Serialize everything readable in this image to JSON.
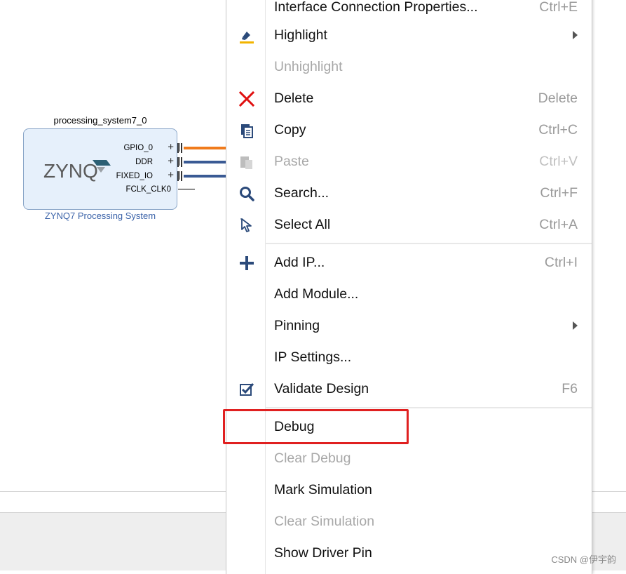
{
  "canvas": {
    "block": {
      "instance_name": "processing_system7_0",
      "logo_text": "ZYNQ",
      "caption": "ZYNQ7 Processing System",
      "ports": [
        {
          "label": "GPIO_0",
          "has_plus": true
        },
        {
          "label": "DDR",
          "has_plus": true
        },
        {
          "label": "FIXED_IO",
          "has_plus": true
        },
        {
          "label": "FCLK_CLK0",
          "has_plus": false
        }
      ]
    },
    "wire_colors": [
      "#f07b1c",
      "#3a5a94",
      "#3a5a94"
    ]
  },
  "menu": {
    "items": [
      {
        "label": "Interface Connection Properties...",
        "shortcut": "Ctrl+E",
        "icon": "",
        "enabled": true
      },
      {
        "label": "Highlight",
        "shortcut": "",
        "icon": "highlight-icon",
        "enabled": true,
        "submenu": true
      },
      {
        "label": "Unhighlight",
        "shortcut": "",
        "icon": "",
        "enabled": false
      },
      {
        "label": "Delete",
        "shortcut": "Delete",
        "icon": "delete-icon",
        "enabled": true
      },
      {
        "label": "Copy",
        "shortcut": "Ctrl+C",
        "icon": "copy-icon",
        "enabled": true
      },
      {
        "label": "Paste",
        "shortcut": "Ctrl+V",
        "icon": "paste-icon",
        "enabled": false
      },
      {
        "label": "Search...",
        "shortcut": "Ctrl+F",
        "icon": "search-icon",
        "enabled": true
      },
      {
        "label": "Select All",
        "shortcut": "Ctrl+A",
        "icon": "select-all-icon",
        "enabled": true
      },
      {
        "label": "Add IP...",
        "shortcut": "Ctrl+I",
        "icon": "add-icon",
        "enabled": true
      },
      {
        "label": "Add Module...",
        "shortcut": "",
        "icon": "",
        "enabled": true
      },
      {
        "label": "Pinning",
        "shortcut": "",
        "icon": "",
        "enabled": true,
        "submenu": true
      },
      {
        "label": "IP Settings...",
        "shortcut": "",
        "icon": "",
        "enabled": true
      },
      {
        "label": "Validate Design",
        "shortcut": "F6",
        "icon": "validate-icon",
        "enabled": true
      },
      {
        "label": "Debug",
        "shortcut": "",
        "icon": "",
        "enabled": true
      },
      {
        "label": "Clear Debug",
        "shortcut": "",
        "icon": "",
        "enabled": false
      },
      {
        "label": "Mark Simulation",
        "shortcut": "",
        "icon": "",
        "enabled": true
      },
      {
        "label": "Clear Simulation",
        "shortcut": "",
        "icon": "",
        "enabled": false
      },
      {
        "label": "Show Driver Pin",
        "shortcut": "",
        "icon": "",
        "enabled": true
      }
    ]
  },
  "annotation": {
    "highlight_color": "#e02020",
    "target": "Debug"
  },
  "watermark": "CSDN @伊宇韵"
}
